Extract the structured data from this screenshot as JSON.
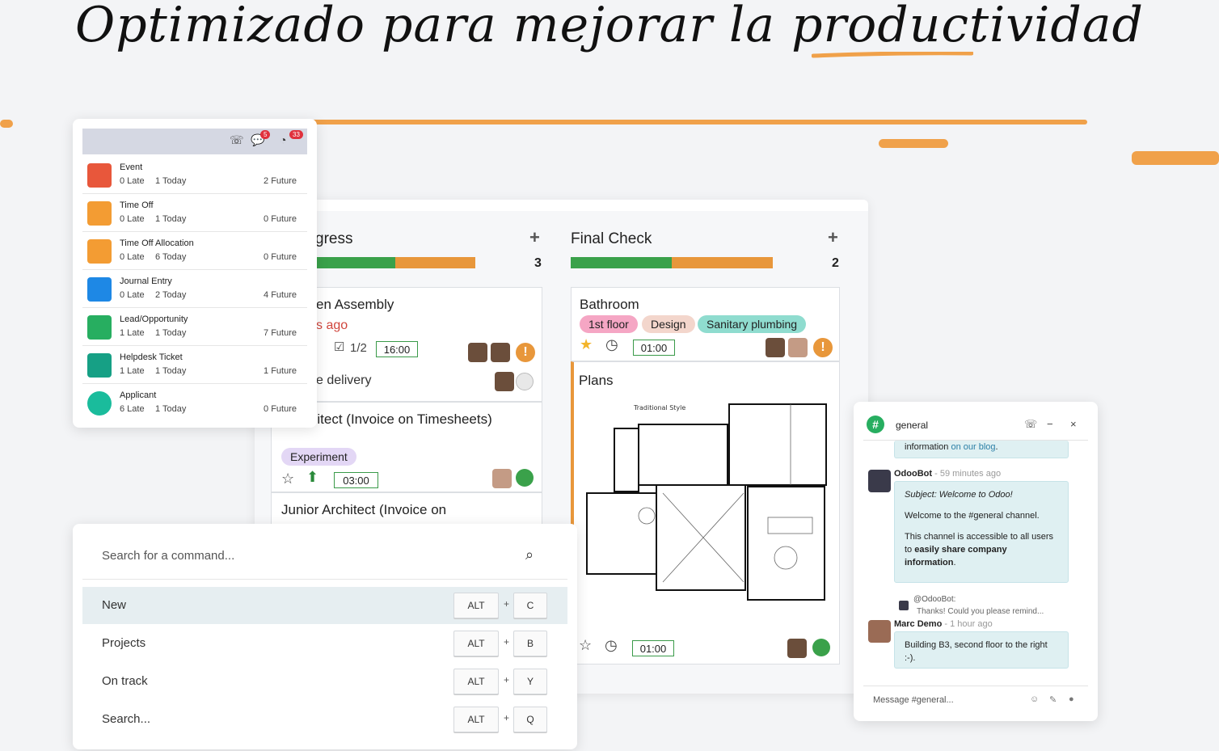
{
  "headline": "Optimizado para mejorar la productividad",
  "colors": {
    "accent_orange": "#f0a14a",
    "green": "#3aa14a",
    "orange": "#e8973b",
    "teal_tag": "#8fdccf",
    "pink_tag": "#f5a6c4",
    "beige_tag": "#f3d6cc",
    "purple_tag": "#e3d7f5"
  },
  "activity": {
    "header_icons": [
      "phone-icon",
      "chat-icon",
      "clock-icon"
    ],
    "chat_badge": "5",
    "activity_badge": "33",
    "rows": [
      {
        "name": "Event",
        "late": "0 Late",
        "today": "1 Today",
        "future": "2 Future",
        "icon": "event-icon"
      },
      {
        "name": "Time Off",
        "late": "0 Late",
        "today": "1 Today",
        "future": "0 Future",
        "icon": "timeoff-icon"
      },
      {
        "name": "Time Off Allocation",
        "late": "0 Late",
        "today": "6 Today",
        "future": "0 Future",
        "icon": "timeoff-icon"
      },
      {
        "name": "Journal Entry",
        "late": "0 Late",
        "today": "2 Today",
        "future": "4 Future",
        "icon": "dollar-icon"
      },
      {
        "name": "Lead/Opportunity",
        "late": "1 Late",
        "today": "1 Today",
        "future": "7 Future",
        "icon": "crm-icon"
      },
      {
        "name": "Helpdesk Ticket",
        "late": "1 Late",
        "today": "1 Today",
        "future": "1 Future",
        "icon": "helpdesk-icon"
      },
      {
        "name": "Applicant",
        "late": "6 Late",
        "today": "1 Today",
        "future": "0 Future",
        "icon": "recruit-icon"
      }
    ]
  },
  "kanban": {
    "col1": {
      "title": "gress",
      "count": "3",
      "progress_green": 0.5,
      "progress_orange": 0.5,
      "card1": {
        "title": "en Assembly",
        "overdue": "s ago",
        "checklist": "1/2",
        "time": "16:00",
        "subtask": "e delivery"
      },
      "card2": {
        "title": "r Architect (Invoice on Timesheets)",
        "tag": "Experiment",
        "time": "03:00"
      },
      "card3": {
        "title": "Junior Architect (Invoice on"
      }
    },
    "col2": {
      "title": "Final Check",
      "count": "2",
      "progress_green": 0.5,
      "progress_orange": 0.5,
      "card1": {
        "title": "Bathroom",
        "tags": [
          "1st floor",
          "Design",
          "Sanitary plumbing"
        ],
        "time": "01:00"
      },
      "card2": {
        "title": "Plans",
        "time": "01:00",
        "plan_caption": "Traditional Style"
      }
    }
  },
  "palette": {
    "placeholder": "Search for a command...",
    "items": [
      {
        "label": "New",
        "key1": "ALT",
        "key2": "C"
      },
      {
        "label": "Projects",
        "key1": "ALT",
        "key2": "B"
      },
      {
        "label": "On track",
        "key1": "ALT",
        "key2": "Y"
      },
      {
        "label": "Search...",
        "key1": "ALT",
        "key2": "Q"
      }
    ],
    "plus": "+"
  },
  "chat": {
    "channel": "general",
    "prev_text": "information",
    "prev_link": "on our blog",
    "prev_period": ".",
    "msg1": {
      "author": "OdooBot",
      "time": "59 minutes ago",
      "subject": "Subject: Welcome to Odoo!",
      "line1": "Welcome to the #general channel.",
      "line2a": "This channel is accessible to all users to ",
      "line2b": "easily share company information",
      "line2c": "."
    },
    "reply": {
      "author": "@OdooBot:",
      "text": "Thanks! Could you please remind..."
    },
    "msg2": {
      "author": "Marc Demo",
      "time": "1 hour ago",
      "text": "Building B3, second floor to the right :-)."
    },
    "input_placeholder": "Message #general..."
  }
}
